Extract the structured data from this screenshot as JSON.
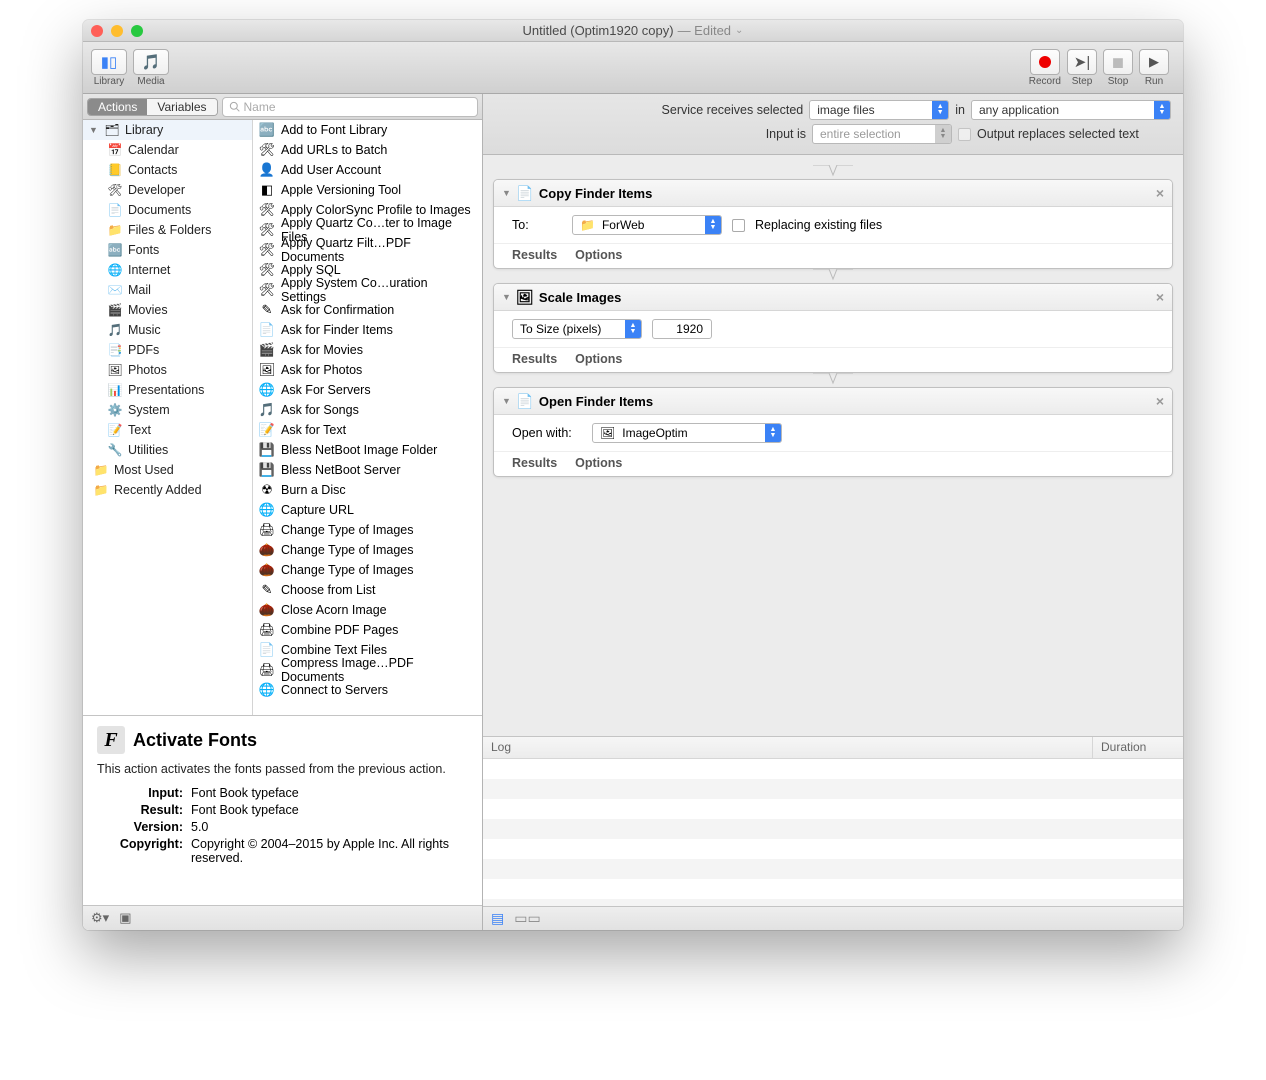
{
  "window": {
    "title_prefix": "Untitled (Optim1920 copy)",
    "edited": "— Edited",
    "chev": "⌄"
  },
  "toolbar": {
    "library": "Library",
    "media": "Media",
    "record": "Record",
    "step": "Step",
    "stop": "Stop",
    "run": "Run"
  },
  "tabs": {
    "actions": "Actions",
    "variables": "Variables"
  },
  "search_placeholder": "Name",
  "categories": {
    "library": "Library",
    "items": [
      {
        "icon": "📅",
        "label": "Calendar"
      },
      {
        "icon": "📒",
        "label": "Contacts"
      },
      {
        "icon": "🛠",
        "label": "Developer"
      },
      {
        "icon": "📄",
        "label": "Documents"
      },
      {
        "icon": "📁",
        "label": "Files & Folders"
      },
      {
        "icon": "🔤",
        "label": "Fonts"
      },
      {
        "icon": "🌐",
        "label": "Internet"
      },
      {
        "icon": "✉️",
        "label": "Mail"
      },
      {
        "icon": "🎬",
        "label": "Movies"
      },
      {
        "icon": "🎵",
        "label": "Music"
      },
      {
        "icon": "📑",
        "label": "PDFs"
      },
      {
        "icon": "🖼",
        "label": "Photos"
      },
      {
        "icon": "📊",
        "label": "Presentations"
      },
      {
        "icon": "⚙️",
        "label": "System"
      },
      {
        "icon": "📝",
        "label": "Text"
      },
      {
        "icon": "🔧",
        "label": "Utilities"
      }
    ],
    "most_used": "Most Used",
    "recently_added": "Recently Added"
  },
  "actions": [
    {
      "icon": "🔤",
      "label": "Add to Font Library"
    },
    {
      "icon": "🛠",
      "label": "Add URLs to Batch"
    },
    {
      "icon": "👤",
      "label": "Add User Account"
    },
    {
      "icon": "◧",
      "label": "Apple Versioning Tool"
    },
    {
      "icon": "🛠",
      "label": "Apply ColorSync Profile to Images"
    },
    {
      "icon": "🛠",
      "label": "Apply Quartz Co…ter to Image Files"
    },
    {
      "icon": "🛠",
      "label": "Apply Quartz Filt…PDF Documents"
    },
    {
      "icon": "🛠",
      "label": "Apply SQL"
    },
    {
      "icon": "🛠",
      "label": "Apply System Co…uration Settings"
    },
    {
      "icon": "✎",
      "label": "Ask for Confirmation"
    },
    {
      "icon": "📄",
      "label": "Ask for Finder Items"
    },
    {
      "icon": "🎬",
      "label": "Ask for Movies"
    },
    {
      "icon": "🖼",
      "label": "Ask for Photos"
    },
    {
      "icon": "🌐",
      "label": "Ask For Servers"
    },
    {
      "icon": "🎵",
      "label": "Ask for Songs"
    },
    {
      "icon": "📝",
      "label": "Ask for Text"
    },
    {
      "icon": "💾",
      "label": "Bless NetBoot Image Folder"
    },
    {
      "icon": "💾",
      "label": "Bless NetBoot Server"
    },
    {
      "icon": "☢",
      "label": "Burn a Disc"
    },
    {
      "icon": "🌐",
      "label": "Capture URL"
    },
    {
      "icon": "🖨",
      "label": "Change Type of Images"
    },
    {
      "icon": "🌰",
      "label": "Change Type of Images"
    },
    {
      "icon": "🌰",
      "label": "Change Type of Images"
    },
    {
      "icon": "✎",
      "label": "Choose from List"
    },
    {
      "icon": "🌰",
      "label": "Close Acorn Image"
    },
    {
      "icon": "🖨",
      "label": "Combine PDF Pages"
    },
    {
      "icon": "📄",
      "label": "Combine Text Files"
    },
    {
      "icon": "🖨",
      "label": "Compress Image…PDF Documents"
    },
    {
      "icon": "🌐",
      "label": "Connect to Servers"
    }
  ],
  "detail": {
    "title": "Activate Fonts",
    "desc": "This action activates the fonts passed from the previous action.",
    "input_k": "Input:",
    "input_v": "Font Book typeface",
    "result_k": "Result:",
    "result_v": "Font Book typeface",
    "version_k": "Version:",
    "version_v": "5.0",
    "copyright_k": "Copyright:",
    "copyright_v": "Copyright © 2004–2015 by Apple Inc. All rights reserved."
  },
  "wf_header": {
    "receives_label": "Service receives selected",
    "receives_value": "image files",
    "in": "in",
    "app_value": "any application",
    "input_is": "Input is",
    "input_value": "entire selection",
    "output_chk": "Output replaces selected text"
  },
  "steps": {
    "copy": {
      "title": "Copy Finder Items",
      "to": "To:",
      "folder": "ForWeb",
      "replacing": "Replacing existing files"
    },
    "scale": {
      "title": "Scale Images",
      "mode": "To Size (pixels)",
      "value": "1920"
    },
    "open": {
      "title": "Open Finder Items",
      "with": "Open with:",
      "app": "ImageOptim"
    },
    "results": "Results",
    "options": "Options"
  },
  "log": {
    "col1": "Log",
    "col2": "Duration"
  }
}
